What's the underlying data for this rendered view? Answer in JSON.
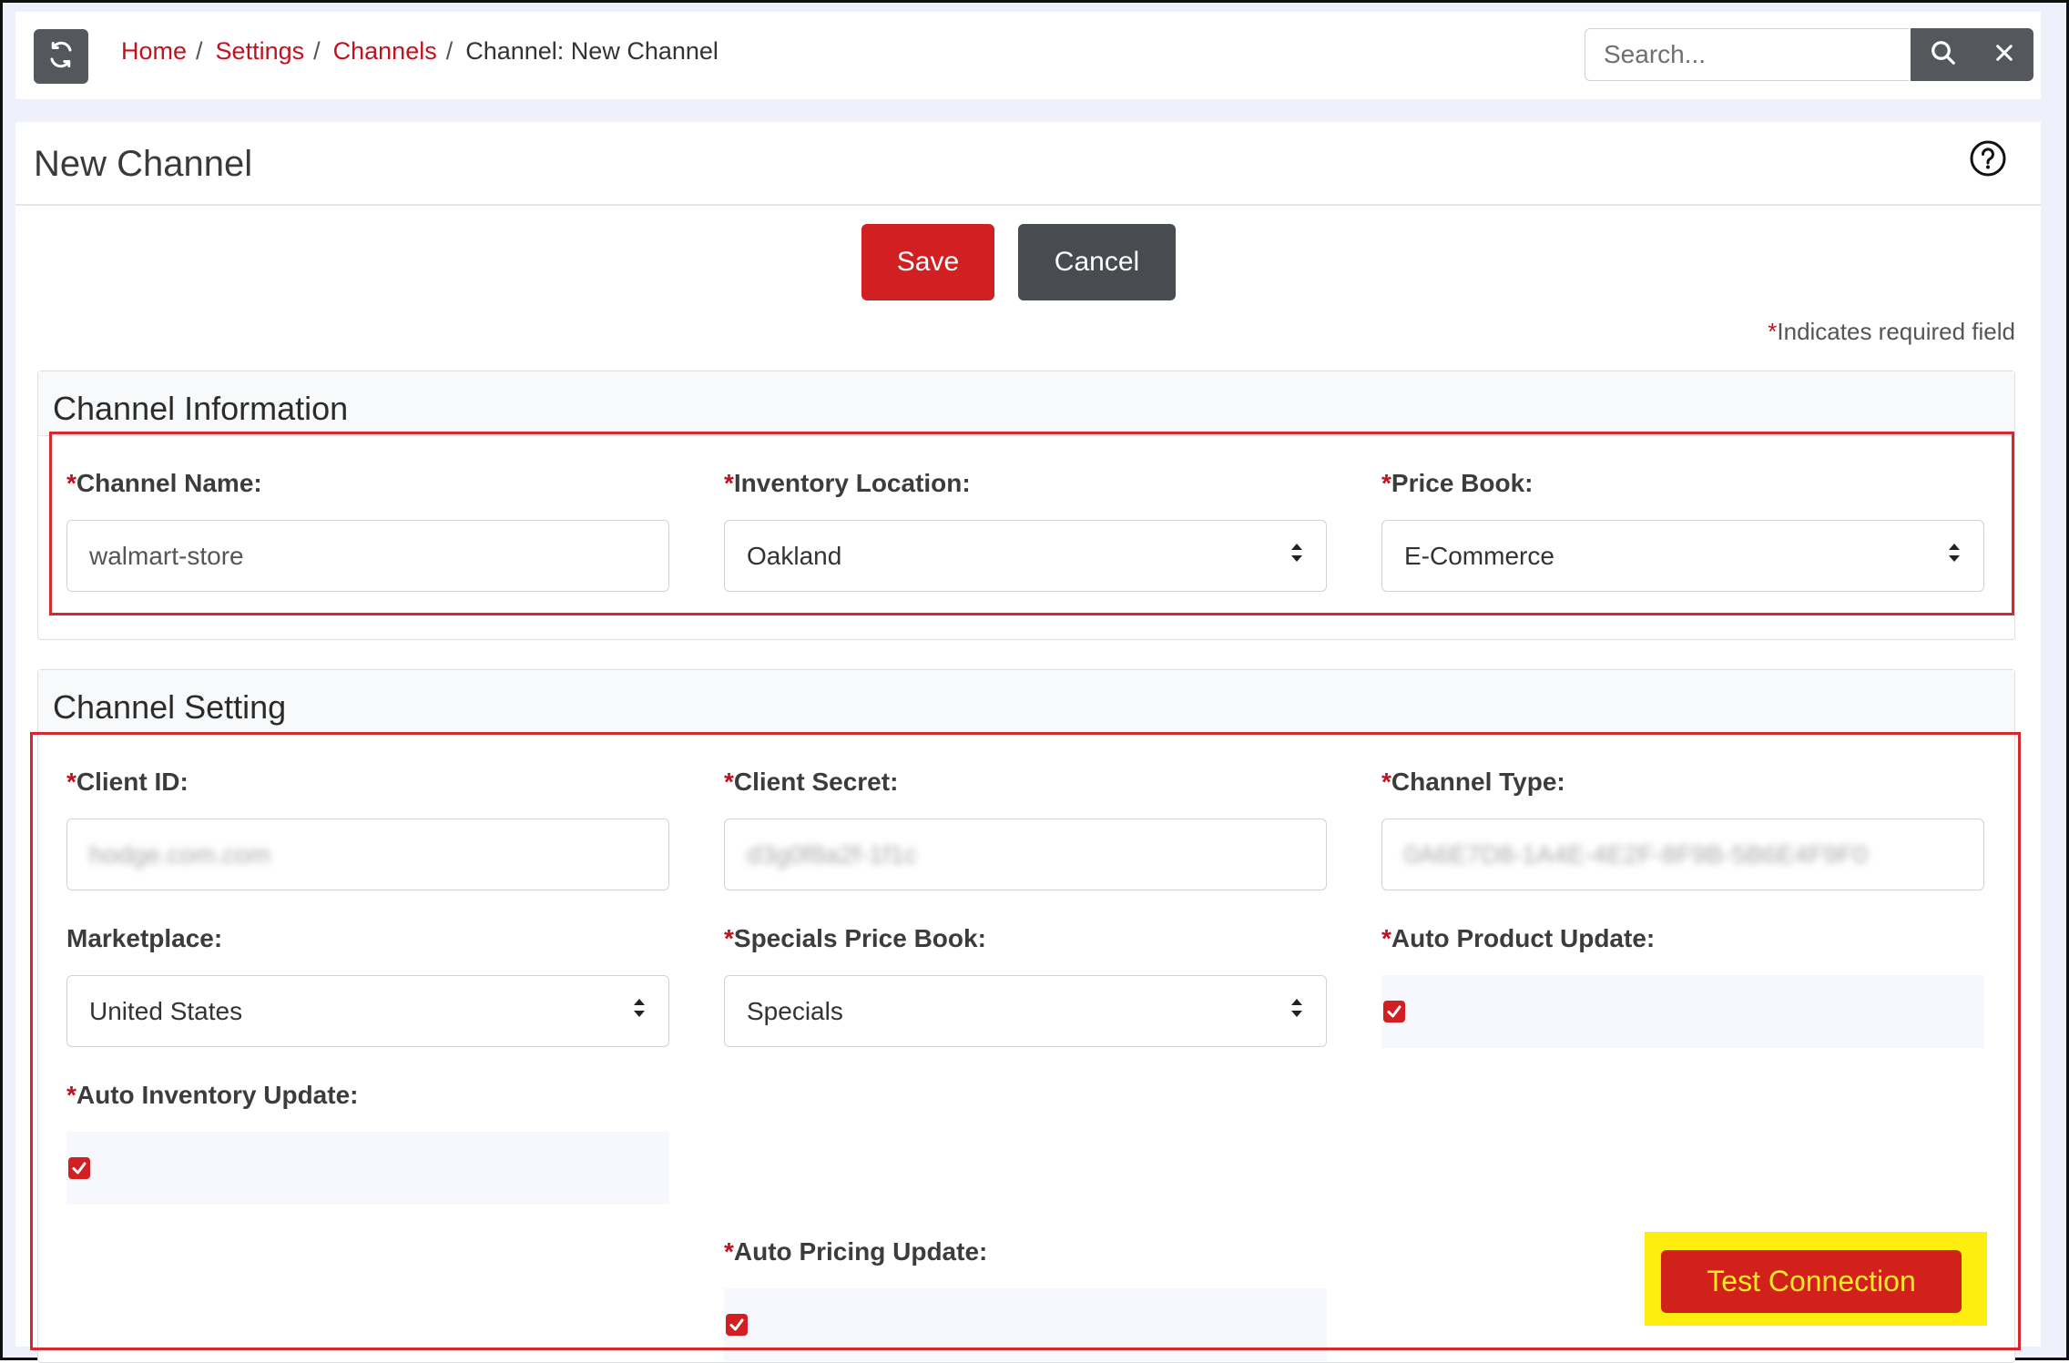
{
  "breadcrumb": {
    "home": "Home",
    "settings": "Settings",
    "channels": "Channels",
    "current": "Channel: New Channel",
    "separator": "/"
  },
  "search": {
    "placeholder": "Search..."
  },
  "page": {
    "title": "New Channel"
  },
  "actions": {
    "save": "Save",
    "cancel": "Cancel"
  },
  "required_note": {
    "star": "*",
    "text": "Indicates required field"
  },
  "channel_information": {
    "title": "Channel Information",
    "channel_name": {
      "label": "Channel Name:",
      "value": "walmart-store"
    },
    "inventory_location": {
      "label": "Inventory Location:",
      "value": "Oakland"
    },
    "price_book": {
      "label": "Price Book:",
      "value": "E-Commerce"
    }
  },
  "channel_setting": {
    "title": "Channel Setting",
    "client_id": {
      "label": "Client ID:",
      "value": "hodge.com.com"
    },
    "client_secret": {
      "label": "Client Secret:",
      "value": "d3g0f8a2f-1f1c"
    },
    "channel_type": {
      "label": "Channel Type:",
      "value": "0A6E7D8-1A4E-4E2F-8F9B-5B6E4F9F0"
    },
    "marketplace": {
      "label": "Marketplace:",
      "value": "United States"
    },
    "specials_price_book": {
      "label": "Specials Price Book:",
      "value": "Specials"
    },
    "auto_product_update": {
      "label": "Auto Product Update:",
      "checked": true
    },
    "auto_inventory_update": {
      "label": "Auto Inventory Update:",
      "checked": true
    },
    "auto_pricing_update": {
      "label": "Auto Pricing Update:",
      "checked": true
    }
  },
  "test_connection": {
    "label": "Test Connection"
  },
  "colors": {
    "accent_red": "#d11f22",
    "dark_button": "#484b50",
    "highlight_yellow": "#fdee10"
  }
}
